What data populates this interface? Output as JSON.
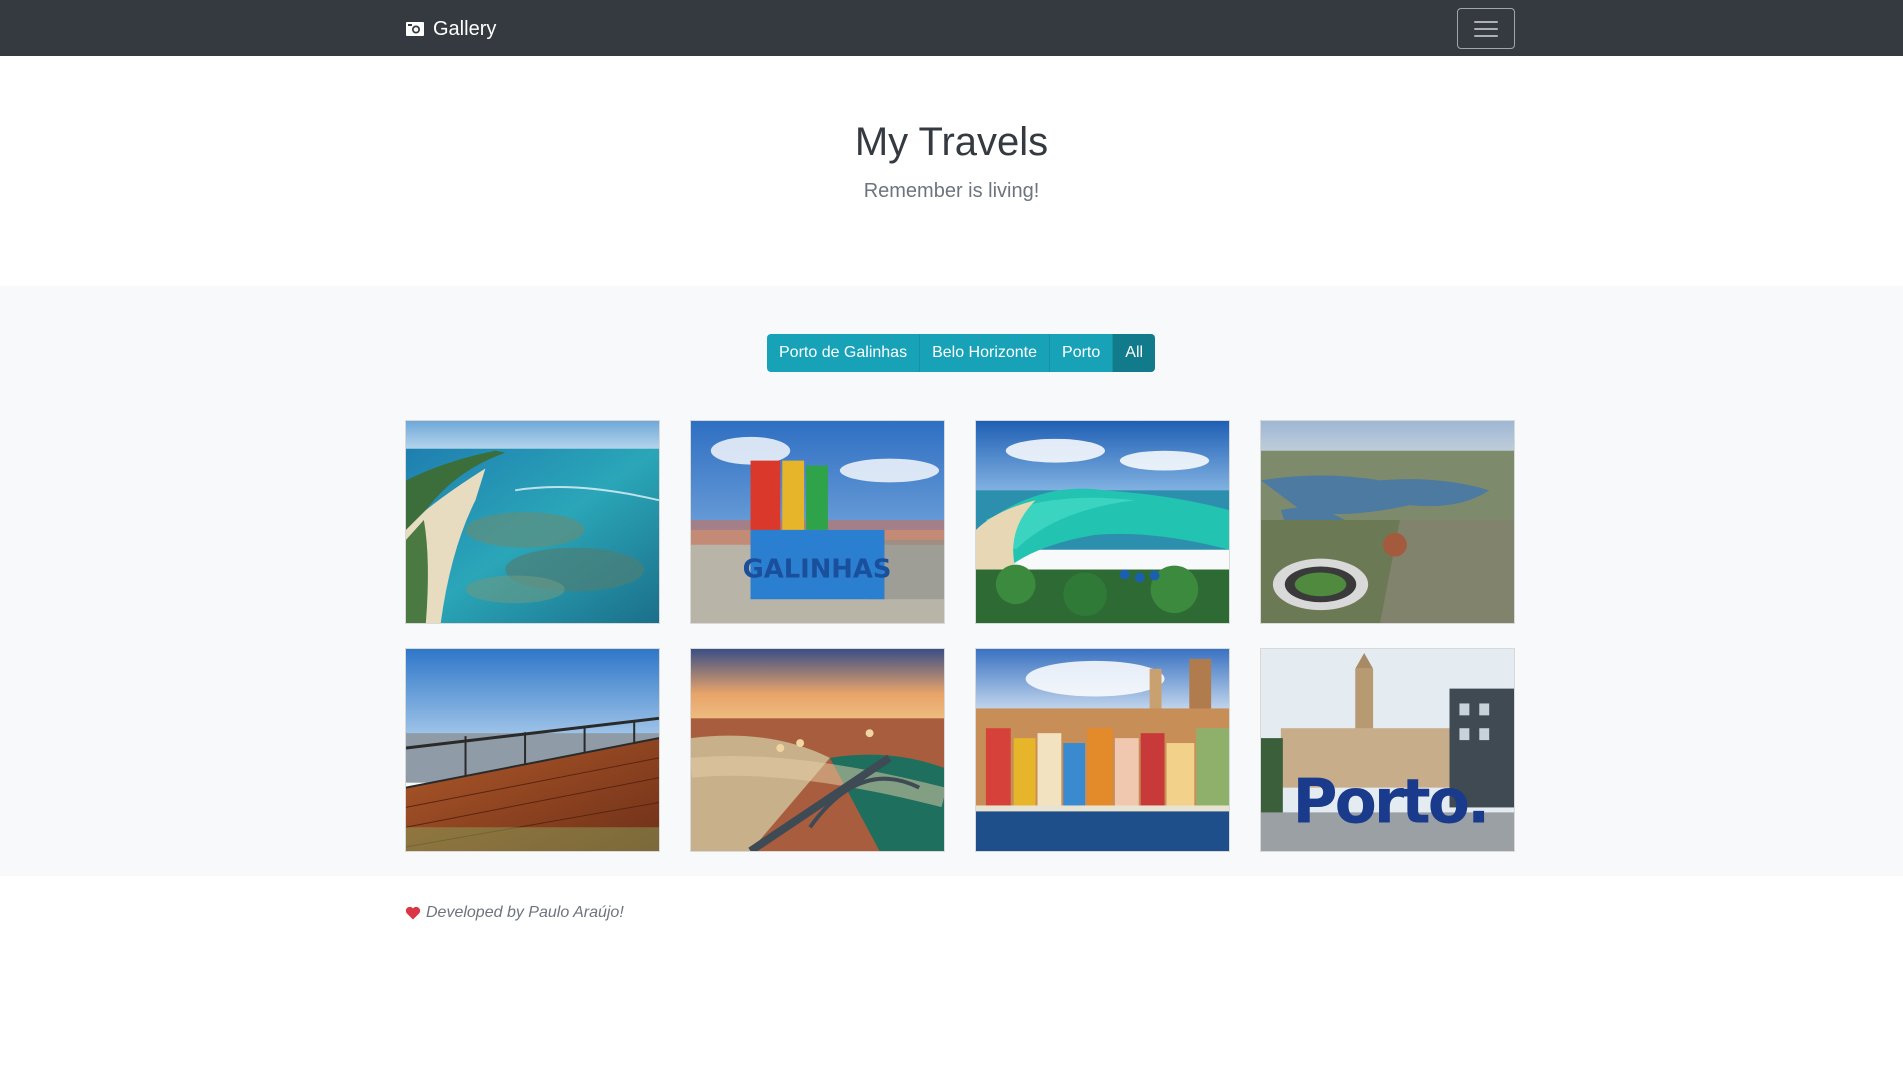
{
  "navbar": {
    "brand_label": "Gallery",
    "brand_icon": "camera-icon",
    "toggler_icon": "hamburger-icon",
    "bg_color": "#343a40"
  },
  "hero": {
    "title": "My Travels",
    "subtitle": "Remember is living!"
  },
  "filters": {
    "buttons": [
      "Porto de Galinhas",
      "Belo Horizonte",
      "Porto",
      "All"
    ],
    "active": "All",
    "color": "#17a2b8",
    "active_color": "#117a8b"
  },
  "gallery": {
    "images": [
      {
        "scene": "aerial-reef-beach",
        "text": ""
      },
      {
        "scene": "porto-de-galinhas-sign",
        "text": "PORTO DE GALINHAS"
      },
      {
        "scene": "bay-beach-palms",
        "text": ""
      },
      {
        "scene": "lagoon-stadium-aerial",
        "text": ""
      },
      {
        "scene": "wooden-deck-city-view",
        "text": ""
      },
      {
        "scene": "porto-sunset-bridge",
        "text": ""
      },
      {
        "scene": "porto-ribeira-colorful",
        "text": ""
      },
      {
        "scene": "porto-sign-city-hall",
        "text": "Porto."
      }
    ]
  },
  "footer": {
    "icon": "heart-icon",
    "text": "Developed by Paulo Araújo!",
    "heart_color": "#dc3545"
  }
}
